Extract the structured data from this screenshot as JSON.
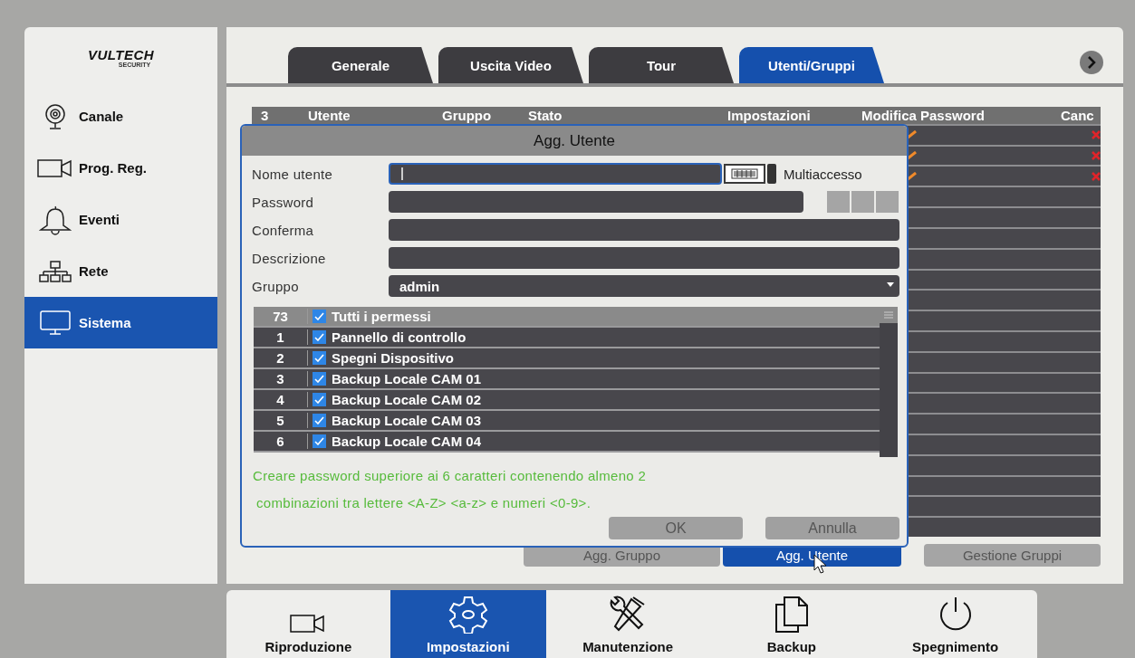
{
  "logo": {
    "name": "VULTECH",
    "subtitle": "SECURITY"
  },
  "sidebar": {
    "items": [
      {
        "label": "Canale",
        "selected": false
      },
      {
        "label": "Prog. Reg.",
        "selected": false
      },
      {
        "label": "Eventi",
        "selected": false
      },
      {
        "label": "Rete",
        "selected": false
      },
      {
        "label": "Sistema",
        "selected": true
      }
    ]
  },
  "tabs": [
    {
      "label": "Generale",
      "selected": false
    },
    {
      "label": "Uscita Video",
      "selected": false
    },
    {
      "label": "Tour",
      "selected": false
    },
    {
      "label": "Utenti/Gruppi",
      "selected": true
    }
  ],
  "users_table": {
    "count": "3",
    "columns": [
      "Utente",
      "Gruppo",
      "Stato",
      "Impostazioni",
      "Modifica Password",
      "Canc"
    ],
    "rows": [
      {
        "kind": "user"
      },
      {
        "kind": "user"
      },
      {
        "kind": "user"
      },
      {
        "kind": "empty"
      },
      {
        "kind": "empty"
      },
      {
        "kind": "empty"
      },
      {
        "kind": "empty"
      },
      {
        "kind": "empty"
      },
      {
        "kind": "empty"
      },
      {
        "kind": "empty"
      },
      {
        "kind": "empty"
      },
      {
        "kind": "empty"
      },
      {
        "kind": "empty"
      },
      {
        "kind": "empty"
      },
      {
        "kind": "empty"
      },
      {
        "kind": "empty"
      },
      {
        "kind": "empty"
      },
      {
        "kind": "empty"
      },
      {
        "kind": "empty"
      },
      {
        "kind": "empty"
      }
    ]
  },
  "dialog": {
    "title": "Agg. Utente",
    "fields": [
      {
        "label": "Nome utente",
        "kind": "name"
      },
      {
        "label": "Password",
        "kind": "password"
      },
      {
        "label": "Conferma",
        "kind": "text"
      },
      {
        "label": "Descrizione",
        "kind": "text"
      },
      {
        "label": "Gruppo",
        "kind": "select",
        "value": "admin"
      }
    ],
    "multi_access": {
      "label": "Multiaccesso",
      "checked": false
    },
    "permissions": {
      "count": "73",
      "label": "Tutti i permessi",
      "checked": true,
      "items": [
        {
          "index": "1",
          "label": "Pannello di controllo",
          "checked": true
        },
        {
          "index": "2",
          "label": "Spegni Dispositivo",
          "checked": true
        },
        {
          "index": "3",
          "label": "Backup Locale CAM 01",
          "checked": true
        },
        {
          "index": "4",
          "label": "Backup Locale CAM 02",
          "checked": true
        },
        {
          "index": "5",
          "label": "Backup Locale CAM 03",
          "checked": true
        },
        {
          "index": "6",
          "label": "Backup Locale CAM 04",
          "checked": true
        }
      ]
    },
    "hint_lines": [
      "Creare password superiore ai 6 caratteri contenendo almeno 2",
      "combinazioni tra lettere <A-Z> <a-z> e numeri <0-9>."
    ],
    "buttons": [
      "OK",
      "Annulla"
    ]
  },
  "actions": [
    {
      "label": "Agg. Gruppo",
      "selected": false
    },
    {
      "label": "Agg. Utente",
      "selected": true
    },
    {
      "label": "Gestione Gruppi",
      "selected": false
    }
  ],
  "bottom_nav": [
    {
      "label": "Riproduzione",
      "selected": false
    },
    {
      "label": "Impostazioni",
      "selected": true
    },
    {
      "label": "Manutenzione",
      "selected": false
    },
    {
      "label": "Backup",
      "selected": false
    },
    {
      "label": "Spegnimento",
      "selected": false
    }
  ]
}
